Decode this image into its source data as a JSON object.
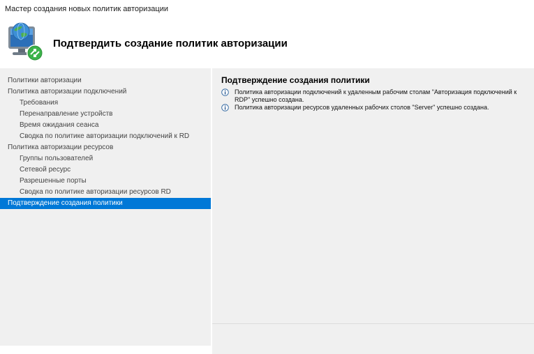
{
  "window": {
    "title": "Мастер создания новых политик авторизации"
  },
  "header": {
    "title": "Подтвердить создание политик авторизации",
    "icon": "network-globe-icon"
  },
  "sidebar": {
    "items": [
      {
        "label": "Политики авторизации",
        "level": 0
      },
      {
        "label": "Политика авторизации подключений",
        "level": 0
      },
      {
        "label": "Требования",
        "level": 1
      },
      {
        "label": "Перенаправление устройств",
        "level": 1
      },
      {
        "label": "Время ожидания сеанса",
        "level": 1
      },
      {
        "label": "Сводка по политике авторизации подключений к RD",
        "level": 1
      },
      {
        "label": "Политика авторизации ресурсов",
        "level": 0
      },
      {
        "label": "Группы пользователей",
        "level": 1
      },
      {
        "label": "Сетевой ресурс",
        "level": 1
      },
      {
        "label": "Разрешенные порты",
        "level": 1
      },
      {
        "label": "Сводка по политике авторизации ресурсов RD",
        "level": 1
      },
      {
        "label": "Подтверждение создания политики",
        "level": 0,
        "selected": true
      }
    ]
  },
  "main": {
    "heading": "Подтверждение создания политики",
    "messages": [
      {
        "icon": "info-icon",
        "text": "Политика авторизации подключений к удаленным рабочим столам \"Авторизация подключений к RDP\" успешно создана."
      },
      {
        "icon": "info-icon",
        "text": "Политика авторизации ресурсов удаленных рабочих столов \"Server\" успешно создана."
      }
    ]
  },
  "colors": {
    "selection": "#0078d7",
    "panel_bg": "#f0f0f0"
  }
}
